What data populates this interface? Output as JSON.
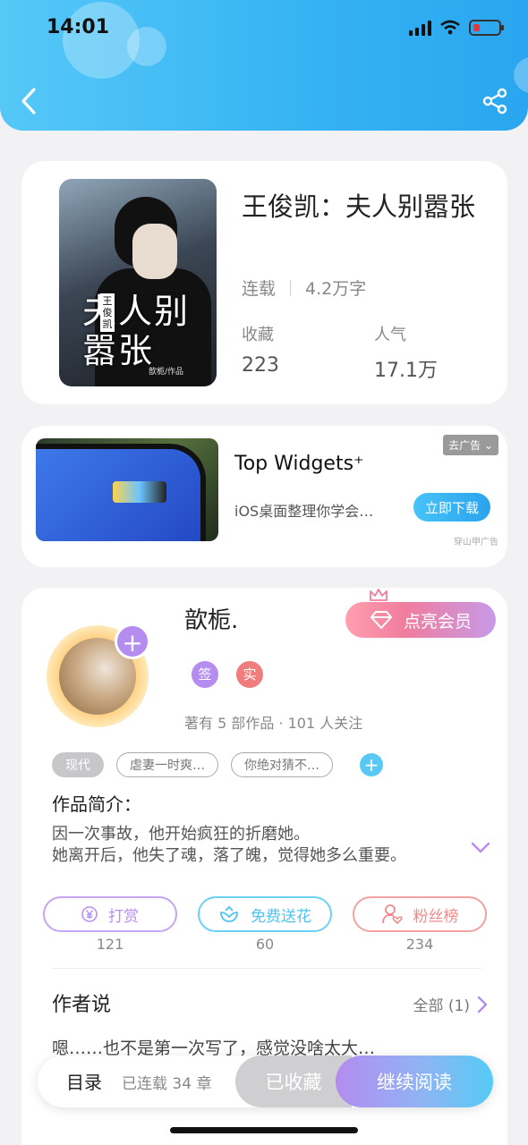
{
  "status_bar": {
    "time": "14:01"
  },
  "book": {
    "title": "王俊凯：夫人别嚣张",
    "cover_text": "夫人别嚣张",
    "cover_author_tag": "王俊凯",
    "cover_small": "歆栀/作品",
    "status": "连载",
    "word_count": "4.2万字",
    "favorites_label": "收藏",
    "favorites_value": "223",
    "popularity_label": "人气",
    "popularity_value": "17.1万"
  },
  "ad": {
    "title": "Top Widgets⁺",
    "description": "iOS桌面整理你学会…",
    "close_label": "去广告",
    "download_label": "立即下载",
    "source": "穿山甲广告"
  },
  "author": {
    "name": "歆栀.",
    "vip_label": "点亮会员",
    "badge_sign": "签",
    "badge_real": "实",
    "works_info": "著有 5 部作品 · 101 人关注",
    "tags": [
      "现代",
      "虐妻一时爽…",
      "你绝对猜不…"
    ],
    "intro_label": "作品简介：",
    "intro_lines": [
      "因一次事故，他开始疯狂的折磨她。",
      "她离开后，他失了魂，落了魄，觉得她多么重要。"
    ],
    "actions": [
      {
        "label": "打赏",
        "count": "121",
        "color": "#b58cf0"
      },
      {
        "label": "免费送花",
        "count": "60",
        "color": "#4fc3f0"
      },
      {
        "label": "粉丝榜",
        "count": "234",
        "color": "#f08a8a"
      }
    ],
    "say_label": "作者说",
    "say_all": "全部 (1)",
    "say_text": "嗯……也不是第一次写了，感觉没啥太大…"
  },
  "bottom_bar": {
    "toc_label": "目录",
    "chapters": "已连载 34 章",
    "fav_label": "已收藏",
    "read_label": "继续阅读"
  },
  "colors": {
    "header": "#35b2f3",
    "accent_purple": "#b58cf0",
    "accent_blue": "#4fc3f0",
    "accent_red": "#f08a8a"
  },
  "icons": [
    "back-arrow-icon",
    "share-icon",
    "crown-icon",
    "diamond-icon",
    "yen-icon",
    "flower-icon",
    "user-heart-icon",
    "chevron-down-icon",
    "chevron-right-icon"
  ]
}
